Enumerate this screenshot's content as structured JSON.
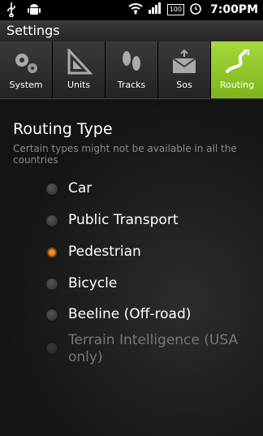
{
  "status": {
    "time": "7:00PM",
    "battery": "100"
  },
  "title": "Settings",
  "tabs": [
    {
      "label": "System",
      "icon": "gears-icon"
    },
    {
      "label": "Units",
      "icon": "ruler-triangle-icon"
    },
    {
      "label": "Tracks",
      "icon": "footprints-icon"
    },
    {
      "label": "Sos",
      "icon": "envelope-icon"
    },
    {
      "label": "Routing",
      "icon": "routing-icon",
      "active": true
    }
  ],
  "routing": {
    "title": "Routing Type",
    "subtitle": "Certain types might not be available in all the countries",
    "options": [
      {
        "label": "Car",
        "selected": false,
        "enabled": true
      },
      {
        "label": "Public Transport",
        "selected": false,
        "enabled": true
      },
      {
        "label": "Pedestrian",
        "selected": true,
        "enabled": true
      },
      {
        "label": "Bicycle",
        "selected": false,
        "enabled": true
      },
      {
        "label": "Beeline (Off-road)",
        "selected": false,
        "enabled": true
      },
      {
        "label": "Terrain Intelligence (USA only)",
        "selected": false,
        "enabled": false
      }
    ]
  },
  "colors": {
    "accent": "#8fc92c",
    "radio_selected": "#ff8a1a"
  }
}
